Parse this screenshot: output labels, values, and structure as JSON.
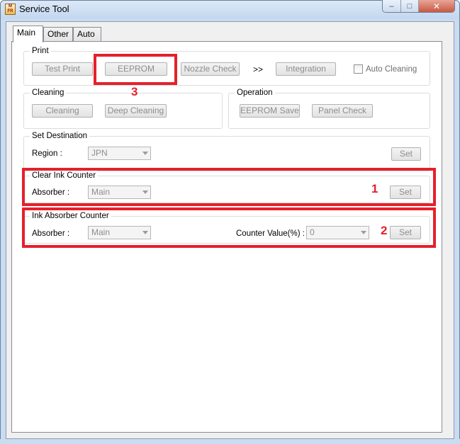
{
  "window": {
    "title": "Service Tool",
    "icon_text": "M\nFR",
    "controls": {
      "minimize": "–",
      "maximize": "□",
      "close": "✕"
    }
  },
  "tabs": [
    "Main",
    "Other",
    "Auto"
  ],
  "print_group": {
    "legend": "Print",
    "test_print": "Test Print",
    "eeprom": "EEPROM",
    "nozzle_check": "Nozzle Check",
    "arrows": ">>",
    "integration": "Integration",
    "auto_cleaning": "Auto Cleaning"
  },
  "cleaning_group": {
    "legend": "Cleaning",
    "cleaning": "Cleaning",
    "deep_cleaning": "Deep Cleaning"
  },
  "operation_group": {
    "legend": "Operation",
    "eeprom_save": "EEPROM Save",
    "panel_check": "Panel Check"
  },
  "set_destination": {
    "legend": "Set Destination",
    "region_label": "Region :",
    "region_value": "JPN",
    "set": "Set"
  },
  "clear_ink_counter": {
    "legend": "Clear Ink Counter",
    "absorber_label": "Absorber :",
    "absorber_value": "Main",
    "set": "Set"
  },
  "ink_absorber_counter": {
    "legend": "Ink Absorber Counter",
    "absorber_label": "Absorber :",
    "absorber_value": "Main",
    "counter_label": "Counter Value(%) :",
    "counter_value": "0",
    "set": "Set"
  },
  "annotations": {
    "one": "1",
    "two": "2",
    "three": "3",
    "color": "#e5202b"
  }
}
